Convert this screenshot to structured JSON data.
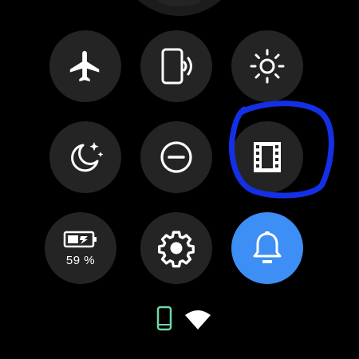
{
  "tiles": [
    {
      "id": "airplane",
      "icon": "airplane-icon",
      "active": false
    },
    {
      "id": "find-phone",
      "icon": "find-phone-icon",
      "active": false
    },
    {
      "id": "brightness",
      "icon": "brightness-icon",
      "active": false
    },
    {
      "id": "bedtime",
      "icon": "moon-stars-icon",
      "active": false
    },
    {
      "id": "do-not-disturb",
      "icon": "minus-circle-icon",
      "active": false
    },
    {
      "id": "theater-mode",
      "icon": "film-icon",
      "active": false
    },
    {
      "id": "battery-saver",
      "icon": "battery-charging-icon",
      "active": false,
      "label": "59 %"
    },
    {
      "id": "settings",
      "icon": "gear-icon",
      "active": false
    },
    {
      "id": "notifications",
      "icon": "bell-icon",
      "active": true
    }
  ],
  "status": {
    "phone_icon": "phone-connected-icon",
    "wifi_icon": "wifi-icon"
  },
  "colors": {
    "background": "#000000",
    "tile": "#242424",
    "active_tile": "#3d8ef5",
    "annotation": "#1430e6",
    "phone_status": "#6fd9a6",
    "icon": "#ffffff"
  }
}
